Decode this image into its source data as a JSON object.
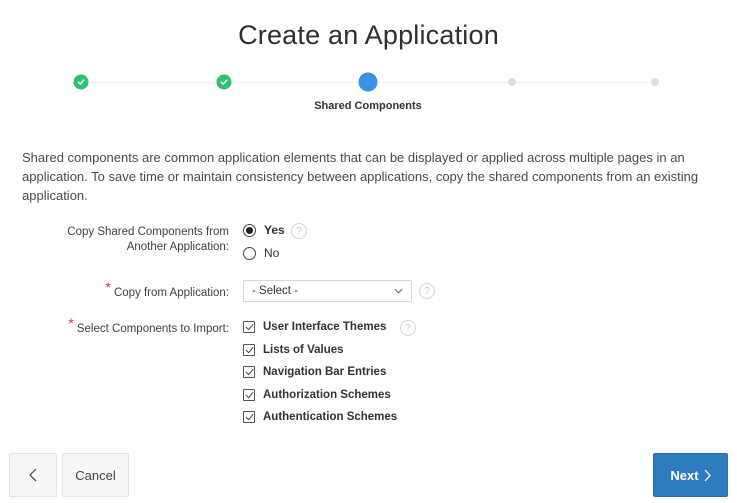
{
  "page": {
    "title": "Create an Application"
  },
  "wizard": {
    "steps": [
      {
        "state": "done",
        "icon": "check-icon"
      },
      {
        "state": "done",
        "icon": "check-icon"
      },
      {
        "state": "current",
        "label": "Shared Components"
      },
      {
        "state": "todo"
      },
      {
        "state": "todo"
      }
    ],
    "current_label": "Shared Components"
  },
  "intro": {
    "text": "Shared components are common application elements that can be displayed or applied across multiple pages in an application. To save time or maintain consistency between applications, copy the shared components from an existing application."
  },
  "form": {
    "copy_shared": {
      "label_line1": "Copy Shared Components from",
      "label_line2": "Another Application:",
      "options": [
        {
          "label": "Yes",
          "selected": true
        },
        {
          "label": "No",
          "selected": false
        }
      ],
      "help_icon": "?"
    },
    "copy_from": {
      "required_marker": "*",
      "label": "Copy from Application:",
      "value": "- Select -",
      "help_icon": "?"
    },
    "components": {
      "required_marker": "*",
      "label": "Select Components to Import:",
      "help_icon": "?",
      "items": [
        {
          "label": "User Interface Themes",
          "checked": true
        },
        {
          "label": "Lists of Values",
          "checked": true
        },
        {
          "label": "Navigation Bar Entries",
          "checked": true
        },
        {
          "label": "Authorization Schemes",
          "checked": true
        },
        {
          "label": "Authentication Schemes",
          "checked": true
        }
      ]
    }
  },
  "footer": {
    "back_icon": "chevron-left-icon",
    "cancel_label": "Cancel",
    "next_label": "Next",
    "next_icon": "chevron-right-icon"
  },
  "colors": {
    "step_done": "#2ebf71",
    "step_current": "#3a93e4",
    "step_todo": "#dedede",
    "primary_button": "#2f7bbf",
    "required": "#e5302d"
  }
}
